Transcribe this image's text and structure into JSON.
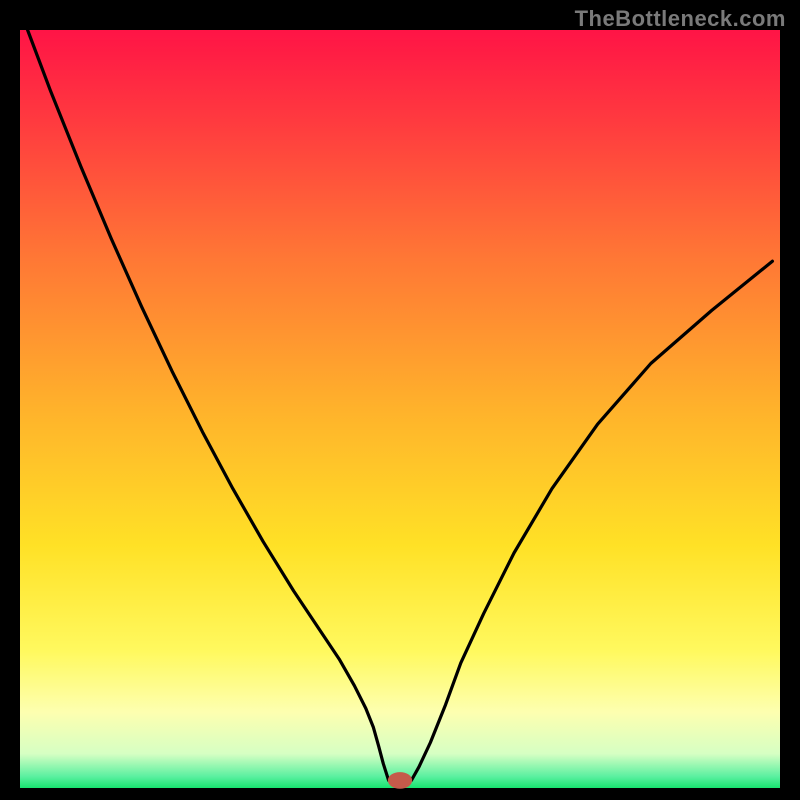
{
  "watermark": {
    "text": "TheBottleneck.com"
  },
  "chart_data": {
    "type": "line",
    "title": "",
    "xlabel": "",
    "ylabel": "",
    "xlim": [
      0,
      100
    ],
    "ylim": [
      0,
      100
    ],
    "legend": null,
    "grid": false,
    "background": {
      "kind": "vertical-gradient",
      "stops": [
        {
          "pos": 0.0,
          "color": "#ff1446"
        },
        {
          "pos": 0.12,
          "color": "#ff3a3f"
        },
        {
          "pos": 0.3,
          "color": "#ff7735"
        },
        {
          "pos": 0.5,
          "color": "#ffb22b"
        },
        {
          "pos": 0.68,
          "color": "#ffe126"
        },
        {
          "pos": 0.82,
          "color": "#fff95f"
        },
        {
          "pos": 0.9,
          "color": "#fdffb0"
        },
        {
          "pos": 0.955,
          "color": "#d6ffc3"
        },
        {
          "pos": 0.985,
          "color": "#5af0a0"
        },
        {
          "pos": 1.0,
          "color": "#18e36f"
        }
      ]
    },
    "series": [
      {
        "name": "bottleneck-curve",
        "color": "#000000",
        "strokeWidth": 3.2,
        "x": [
          1.0,
          4,
          8,
          12,
          16,
          20,
          24,
          28,
          32,
          36,
          40,
          42,
          44,
          45.5,
          46.5,
          47.2,
          47.8,
          48.5,
          51.5,
          52.5,
          54,
          56,
          58,
          61,
          65,
          70,
          76,
          83,
          91,
          99.0
        ],
        "y": [
          100,
          92,
          82,
          72.5,
          63.5,
          55,
          47,
          39.5,
          32.5,
          26,
          20,
          17,
          13.5,
          10.5,
          8,
          5.5,
          3.2,
          1.0,
          1.0,
          2.8,
          6,
          11,
          16.5,
          23,
          31,
          39.5,
          48,
          56,
          63,
          69.5
        ]
      }
    ],
    "marker": {
      "name": "optimal-point",
      "x": 50.0,
      "y": 1.0,
      "color": "#c55a4a",
      "rx": 1.6,
      "ry": 1.1
    },
    "flat_bottom_segment": {
      "x0": 46.8,
      "x1": 53.0,
      "y": 1.0
    },
    "annotations": []
  },
  "canvas": {
    "outer_w": 800,
    "outer_h": 800,
    "inner_x": 20,
    "inner_y": 30,
    "inner_w": 760,
    "inner_h": 758
  }
}
